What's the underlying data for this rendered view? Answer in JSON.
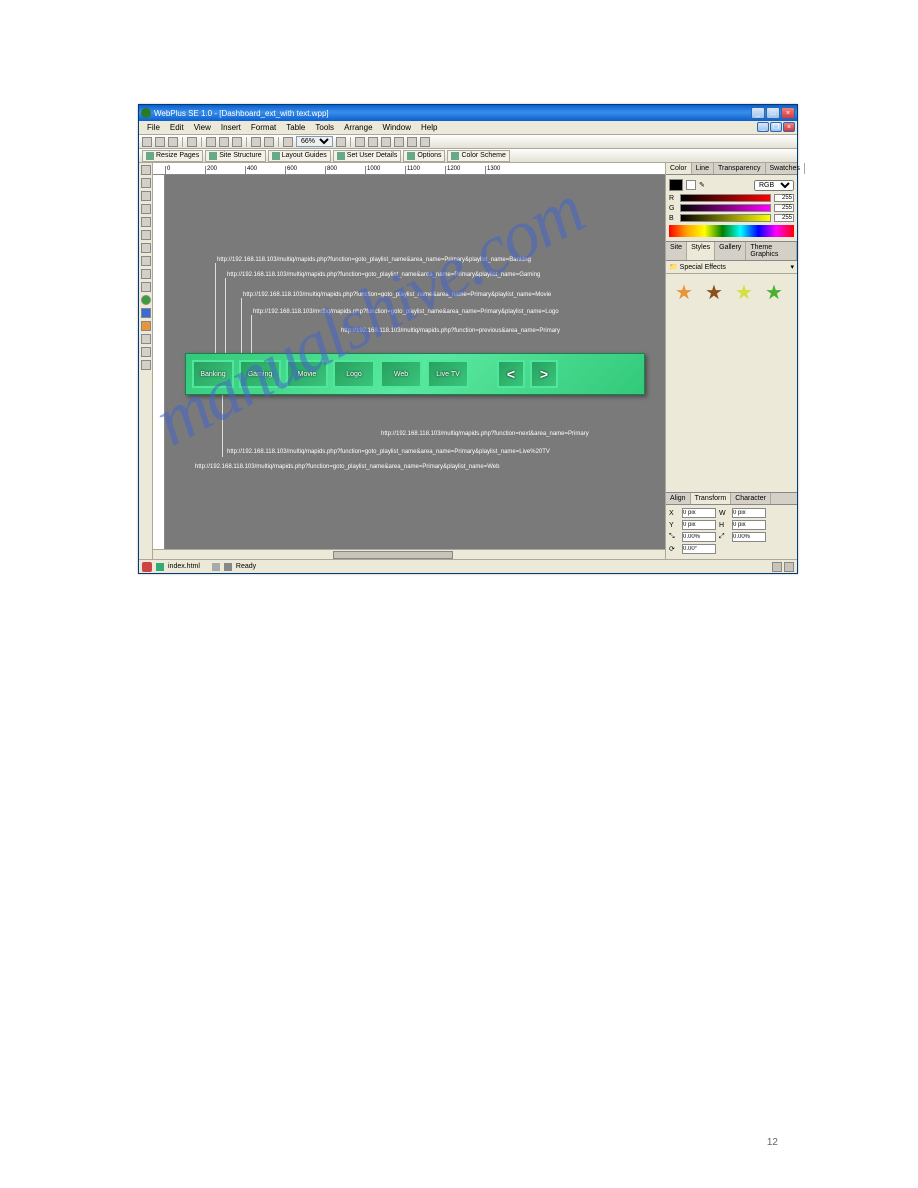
{
  "title": "WebPlus SE 1.0 - [Dashboard_ext_with text.wpp]",
  "menu": [
    "File",
    "Edit",
    "View",
    "Insert",
    "Format",
    "Table",
    "Tools",
    "Arrange",
    "Window",
    "Help"
  ],
  "toolbar1_zoom": "66%",
  "toolbar2": {
    "resize": "Resize Pages",
    "sitestruct": "Site Structure",
    "layout": "Layout Guides",
    "userdetails": "Set User Details",
    "options": "Options",
    "colorscheme": "Color Scheme"
  },
  "ruler_marks": [
    "0",
    "200",
    "400",
    "600",
    "800",
    "1000",
    "1100",
    "1200",
    "1300"
  ],
  "annotations": [
    "http://192.168.118.103/multiq/mapids.php?function=goto_playlist_name&area_name=Primary&playlist_name=Banking",
    "http://192.168.118.103/multiq/mapids.php?function=goto_playlist_name&area_name=Primary&playlist_name=Gaming",
    "http://192.168.118.103/multiq/mapids.php?function=goto_playlist_name&area_name=Primary&playlist_name=Movie",
    "http://192.168.118.103/multiq/mapids.php?function=goto_playlist_name&area_name=Primary&playlist_name=Logo",
    "http://192.168.118.103/multiq/mapids.php?function=previous&area_name=Primary",
    "http://192.168.118.103/multiq/mapids.php?function=next&area_name=Primary",
    "http://192.168.118.103/multiq/mapids.php?function=goto_playlist_name&area_name=Primary&playlist_name=Live%20TV",
    "http://192.168.118.103/multiq/mapids.php?function=goto_playlist_name&area_name=Primary&playlist_name=Web"
  ],
  "greenbtns": [
    "Banking",
    "Gaming",
    "Movie",
    "Logo",
    "Web",
    "Live TV"
  ],
  "nav_prev": "<",
  "nav_next": ">",
  "right": {
    "color_tabs": [
      "Color",
      "Line",
      "Transparency",
      "Swatches"
    ],
    "color_mode": "RGB",
    "r_label": "R",
    "g_label": "G",
    "b_label": "B",
    "r_val": "255",
    "g_val": "255",
    "b_val": "255",
    "styles_tabs": [
      "Site",
      "Styles",
      "Gallery",
      "Theme Graphics"
    ],
    "effects_label": "Special Effects",
    "xform_tabs": [
      "Align",
      "Transform",
      "Character"
    ],
    "x_label": "X",
    "y_label": "Y",
    "x_val": "0 pix",
    "y_val": "0 pix",
    "w_label": "W",
    "h_label": "H",
    "w_val": "0 pix",
    "h_val": "0 pix",
    "sx_val": "0.00%",
    "sy_val": "0.00%",
    "rot_val": "0.00°"
  },
  "status": {
    "doc": "index.html",
    "ready": "Ready"
  },
  "watermark": "manualshive.com",
  "pagenum": "12"
}
